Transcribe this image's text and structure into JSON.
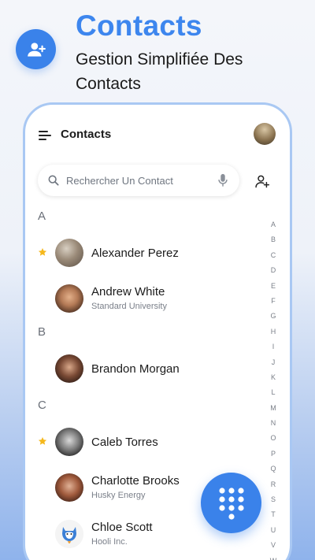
{
  "promo": {
    "title": "Contacts",
    "subtitle": "Gestion Simplifiée Des Contacts",
    "icon": "add-person-icon",
    "accent_color": "#3a82ea"
  },
  "app_bar": {
    "title": "Contacts",
    "menu_icon": "hamburger-menu-icon"
  },
  "search": {
    "placeholder": "Rechercher Un Contact",
    "value": ""
  },
  "sections": [
    {
      "letter": "A"
    },
    {
      "letter": "B"
    },
    {
      "letter": "C"
    }
  ],
  "contacts": [
    {
      "name": "Alexander Perez",
      "subtitle": "",
      "favorite": true
    },
    {
      "name": "Andrew White",
      "subtitle": "Standard University",
      "favorite": false
    },
    {
      "name": "Brandon Morgan",
      "subtitle": "",
      "favorite": false
    },
    {
      "name": "Caleb Torres",
      "subtitle": "",
      "favorite": true
    },
    {
      "name": "Charlotte Brooks",
      "subtitle": "Husky Energy",
      "favorite": false
    },
    {
      "name": "Chloe Scott",
      "subtitle": "Hooli Inc.",
      "favorite": false
    }
  ],
  "alphabet_index": [
    "A",
    "B",
    "C",
    "D",
    "E",
    "F",
    "G",
    "H",
    "I",
    "J",
    "K",
    "L",
    "M",
    "N",
    "O",
    "P",
    "Q",
    "R",
    "S",
    "T",
    "U",
    "V",
    "W"
  ],
  "fab": {
    "icon": "dialpad-icon"
  },
  "colors": {
    "accent": "#3a82ea",
    "star": "#f5b81c"
  }
}
